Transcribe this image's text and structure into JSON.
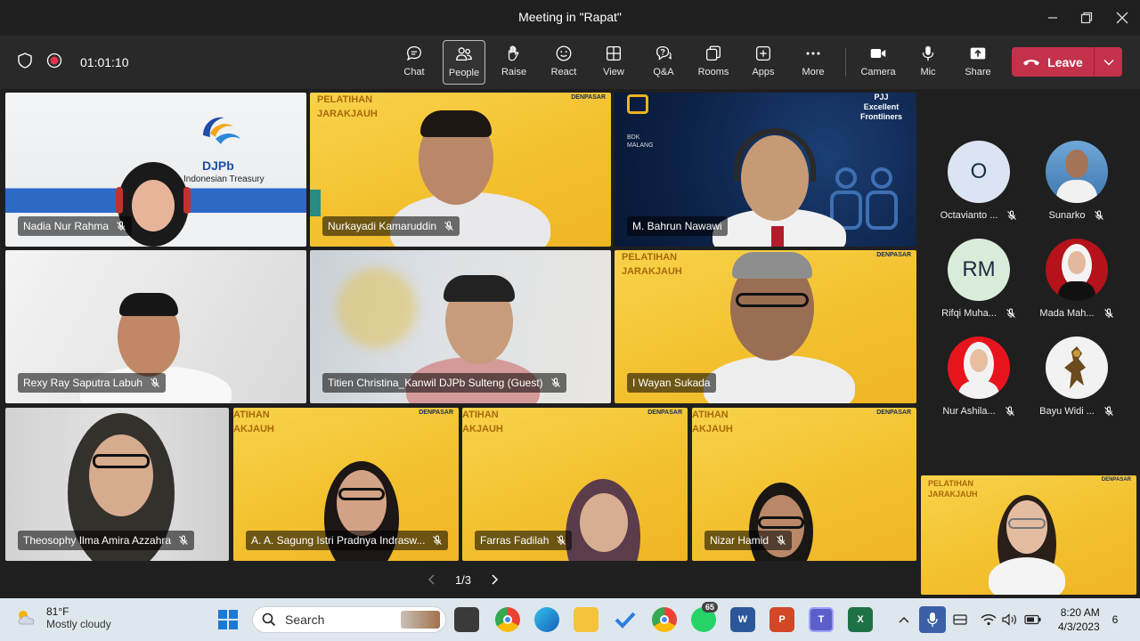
{
  "window": {
    "title": "Meeting in \"Rapat\""
  },
  "meeting": {
    "elapsed": "01:01:10"
  },
  "toolbar": {
    "chat": "Chat",
    "people": "People",
    "raise": "Raise",
    "react": "React",
    "view": "View",
    "qa": "Q&A",
    "rooms": "Rooms",
    "apps": "Apps",
    "more": "More",
    "camera": "Camera",
    "mic": "Mic",
    "share": "Share",
    "leave": "Leave"
  },
  "tiles": [
    {
      "name": "Nadia Nur Rahma"
    },
    {
      "name": "Nurkayadi Kamaruddin"
    },
    {
      "name": "M. Bahrun Nawawi"
    },
    {
      "name": "Rexy Ray Saputra Labuh"
    },
    {
      "name": "Titien Christina_Kanwil DJPb Sulteng (Guest)"
    },
    {
      "name": "I Wayan Sukada"
    },
    {
      "name": "Theosophy Ilma Amira Azzahra"
    },
    {
      "name": "A. A. Sagung Istri Pradnya Indrasw..."
    },
    {
      "name": "Farras Fadilah"
    },
    {
      "name": "Nizar Hamid"
    }
  ],
  "backgrounds": {
    "pelatihan_line1": "PELATIHAN",
    "pelatihan_line2": "JARAKJAUH",
    "pelatihan_cut1": "ATIHAN",
    "pelatihan_cut2": "AKJAUH",
    "denpasar": "DENPASAR",
    "djpb": "DJPb",
    "treasury": "Indonesian Treasury",
    "pjj": "PJJ",
    "excellent": "Excellent",
    "frontliners": "Frontliners",
    "bdk": "BDK",
    "malang": "MALANG"
  },
  "roster": [
    {
      "initials": "O",
      "name": "Octavianto ...",
      "color": "#dbe4f2"
    },
    {
      "initials": "",
      "name": "Sunarko",
      "color": "#4a7fb5"
    },
    {
      "initials": "RM",
      "name": "Rifqi Muha...",
      "color": "#d9ecd9"
    },
    {
      "initials": "",
      "name": "Mada Mah...",
      "color": "#b5121b"
    },
    {
      "initials": "",
      "name": "Nur Ashila...",
      "color": "#e8141d"
    },
    {
      "initials": "",
      "name": "Bayu Widi ...",
      "color": "#f2f2f2"
    }
  ],
  "pager": {
    "label": "1/3"
  },
  "taskbar": {
    "temp": "81°F",
    "condition": "Mostly cloudy",
    "search": "Search",
    "time": "8:20 AM",
    "date": "4/3/2023",
    "notifications": "6",
    "whatsapp_badge": "65"
  },
  "colors": {
    "leave": "#c4314b",
    "toolbar": "#292929",
    "stage": "#1f1f1f",
    "taskbar": "#dfe7ee"
  }
}
